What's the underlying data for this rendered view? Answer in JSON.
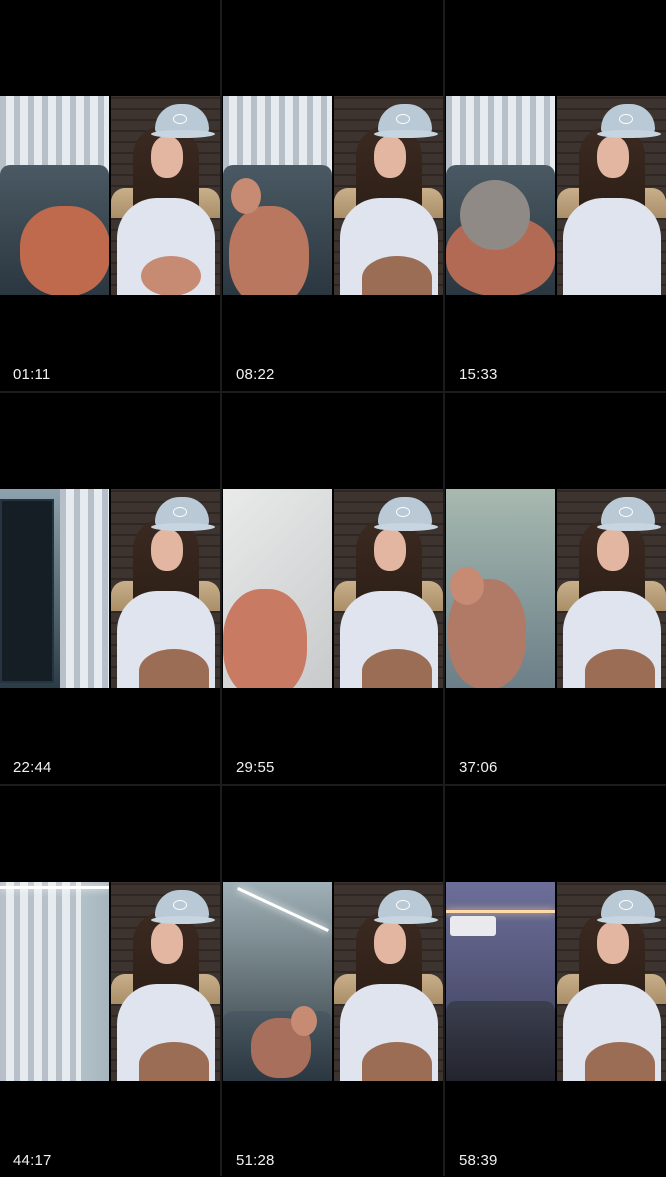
{
  "grid": {
    "timestamps": [
      "01:11",
      "08:22",
      "15:33",
      "22:44",
      "29:55",
      "37:06",
      "44:17",
      "51:28",
      "58:39"
    ]
  },
  "colors": {
    "background": "#000000",
    "timestamp_text": "#f2f2f2"
  }
}
